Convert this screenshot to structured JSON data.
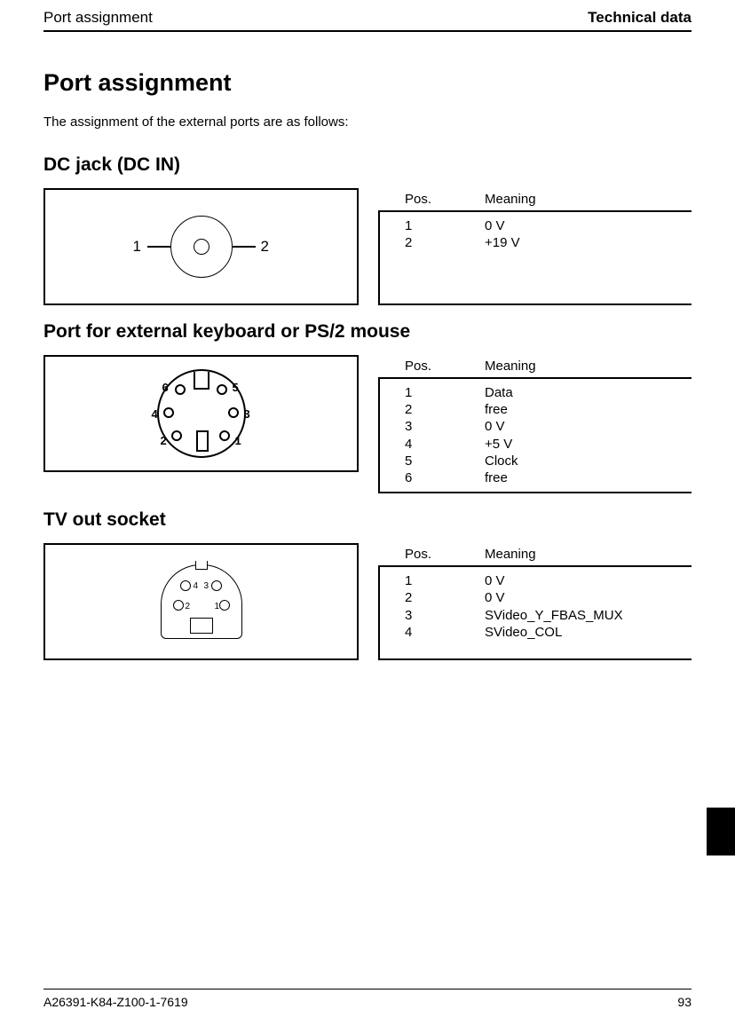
{
  "header": {
    "left": "Port assignment",
    "right": "Technical data"
  },
  "h1": "Port assignment",
  "intro": "The assignment of the external ports are as follows:",
  "table_head": {
    "pos": "Pos.",
    "meaning": "Meaning"
  },
  "sections": {
    "dc": {
      "title": "DC jack (DC IN)",
      "labels": {
        "l1": "1",
        "l2": "2"
      },
      "rows": [
        {
          "pos": "1",
          "meaning": "0 V"
        },
        {
          "pos": "2",
          "meaning": "+19 V"
        }
      ]
    },
    "ps2": {
      "title": "Port for external keyboard or PS/2 mouse",
      "labels": {
        "l1": "1",
        "l2": "2",
        "l3": "3",
        "l4": "4",
        "l5": "5",
        "l6": "6"
      },
      "rows": [
        {
          "pos": "1",
          "meaning": "Data"
        },
        {
          "pos": "2",
          "meaning": "free"
        },
        {
          "pos": "3",
          "meaning": "0 V"
        },
        {
          "pos": "4",
          "meaning": "+5 V"
        },
        {
          "pos": "5",
          "meaning": "Clock"
        },
        {
          "pos": "6",
          "meaning": "free"
        }
      ]
    },
    "tv": {
      "title": "TV out socket",
      "labels": {
        "l1": "1",
        "l2": "2",
        "l3": "3",
        "l4": "4"
      },
      "rows": [
        {
          "pos": "1",
          "meaning": "0 V"
        },
        {
          "pos": "2",
          "meaning": "0 V"
        },
        {
          "pos": "3",
          "meaning": "SVideo_Y_FBAS_MUX"
        },
        {
          "pos": "4",
          "meaning": "SVideo_COL"
        }
      ]
    }
  },
  "footer": {
    "docnum": "A26391-K84-Z100-1-7619",
    "page": "93"
  }
}
